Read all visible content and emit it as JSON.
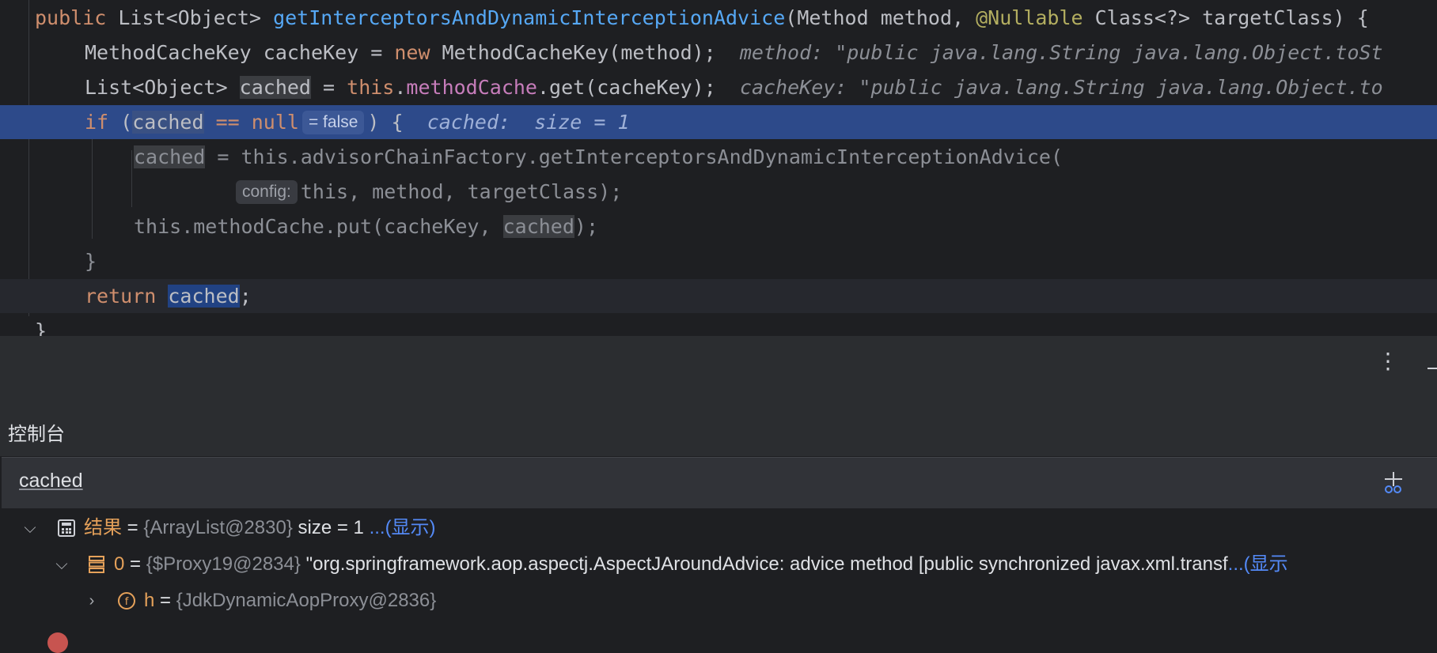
{
  "editor": {
    "line1": {
      "kw_public": "public",
      "type_list": "List<Object>",
      "method_name": "getInterceptorsAndDynamicInterceptionAdvice",
      "params_a": "(Method method, ",
      "annotation": "@Nullable",
      "params_b": " Class<?> targetClass) {"
    },
    "line2": {
      "a": "MethodCacheKey cacheKey = ",
      "kw_new": "new",
      "b": " MethodCacheKey(method);",
      "hint": "method: \"public java.lang.String java.lang.Object.toSt"
    },
    "line3": {
      "a": "List<Object> ",
      "var": "cached",
      "b": " = ",
      "kw_this": "this",
      "dot": ".",
      "field": "methodCache",
      "c": ".get(cacheKey);",
      "hint": "cacheKey: \"public java.lang.String java.lang.Object.to"
    },
    "line4": {
      "kw_if": "if",
      "paren": " (",
      "var": "cached",
      "cmp": " == null",
      "inlay": "= false",
      "close": ") {",
      "hint": "cached:  size = 1"
    },
    "line5": {
      "var": "cached",
      "rest": " = this.advisorChainFactory.getInterceptorsAndDynamicInterceptionAdvice("
    },
    "line6": {
      "inlay": "config:",
      "rest": "this, method, targetClass);"
    },
    "line7": {
      "a": "this.methodCache.put(cacheKey, ",
      "var": "cached",
      "b": ");"
    },
    "line8": {
      "brace": "}"
    },
    "line9": {
      "kw_return": "return",
      "sp": " ",
      "var": "cached",
      "semi": ";"
    },
    "line10": {
      "brace": "}"
    }
  },
  "console": {
    "title": "控制台",
    "evaluate_expression": "cached"
  },
  "tree": {
    "row1": {
      "name": "结果",
      "eq": " = ",
      "ref": "{ArrayList@2830}",
      "value": "  size = 1 ",
      "link": "...(显示)"
    },
    "row2": {
      "name": "0",
      "eq": " = ",
      "ref": "{$Proxy19@2834}",
      "value": " \"org.springframework.aop.aspectj.AspectJAroundAdvice: advice method [public synchronized javax.xml.transf",
      "link": "...(显示"
    },
    "row3": {
      "name": "h",
      "eq": " = ",
      "ref": "{JdkDynamicAopProxy@2836}"
    }
  },
  "colors": {
    "editor_bg": "#1e1f22",
    "current_line": "#2d4a8a",
    "keyword": "#cf8e6d",
    "method": "#56a8f5",
    "field": "#c77dbb",
    "annotation": "#b3ae60",
    "tree_name": "#e5a15a",
    "link": "#548af7"
  }
}
